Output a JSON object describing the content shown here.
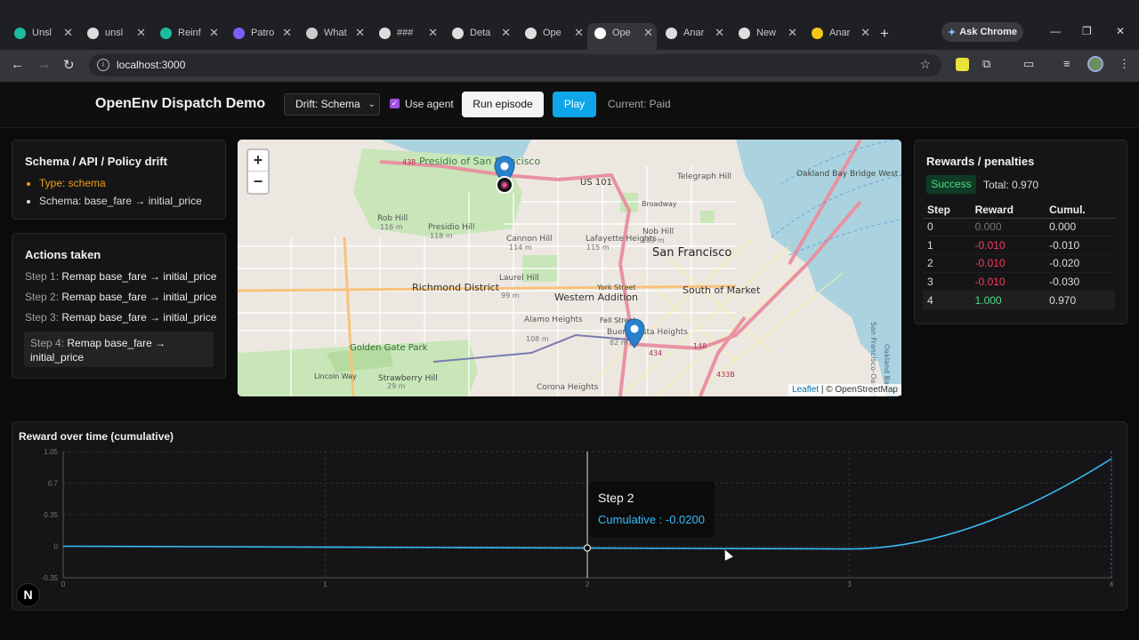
{
  "browser": {
    "tabs": [
      {
        "label": "Unsl",
        "color": "#1abc9c"
      },
      {
        "label": "unsl",
        "color": "#dddddd"
      },
      {
        "label": "Reinf",
        "color": "#1abc9c"
      },
      {
        "label": "Patro",
        "color": "#7c5cff"
      },
      {
        "label": "What",
        "color": "#cccccc"
      },
      {
        "label": "###",
        "color": "#dddddd"
      },
      {
        "label": "Deta",
        "color": "#dddddd"
      },
      {
        "label": "Ope",
        "color": "#dddddd"
      },
      {
        "label": "Ope",
        "color": "#ffffff"
      },
      {
        "label": "Anar",
        "color": "#dddddd"
      },
      {
        "label": "New",
        "color": "#dddddd"
      },
      {
        "label": "Anar",
        "color": "#f5c518"
      }
    ],
    "active_tab_index": 8,
    "ask_chrome": "Ask Chrome",
    "url": "localhost:3000"
  },
  "header": {
    "title": "OpenEnv Dispatch Demo",
    "drift_select": "Drift: Schema",
    "use_agent": "Use agent",
    "use_agent_checked": true,
    "run_button": "Run episode",
    "play_button": "Play",
    "current": "Current: Paid"
  },
  "drift": {
    "title": "Schema / API / Policy drift",
    "type": "Type: schema",
    "schema": "Schema: base_fare → initial_price",
    "type_color": "#f59e0b"
  },
  "actions": {
    "title": "Actions taken",
    "items": [
      {
        "step": "Step 1:",
        "text": "Remap base_fare → initial_price"
      },
      {
        "step": "Step 2:",
        "text": "Remap base_fare → initial_price"
      },
      {
        "step": "Step 3:",
        "text": "Remap base_fare → initial_price"
      },
      {
        "step": "Step 4:",
        "text": "Remap base_fare → initial_price"
      }
    ]
  },
  "map": {
    "labels": [
      "Presidio of San Francisco",
      "US 101",
      "Rob Hill",
      "116 m",
      "Presidio Hill",
      "118 m",
      "Cannon Hill",
      "114 m",
      "Lafayette Heights",
      "115 m",
      "Telegraph Hill",
      "Broadway",
      "Nob Hill",
      "103 m",
      "San Francisco",
      "Oakland Bay Bridge West Span",
      "San Francisco-Oakland Bay Bridge",
      "Richmond District",
      "Laurel Hill",
      "99 m",
      "Western Addition",
      "York Street",
      "South of Market",
      "Fell Street",
      "Alamo Heights",
      "108 m",
      "Buena Vista Heights",
      "82 m",
      "Golden Gate Park",
      "Strawberry Hill",
      "Lincoln Way",
      "29 m",
      "Corona Heights",
      "438",
      "434",
      "433B",
      "148",
      "Oakland Bay St"
    ],
    "attribution_link": "Leaflet",
    "attribution_text": "| © OpenStreetMap"
  },
  "rewards": {
    "title": "Rewards / penalties",
    "badge": "Success",
    "total": "Total: 0.970",
    "columns": [
      "Step",
      "Reward",
      "Cumul."
    ],
    "rows": [
      {
        "step": "0",
        "reward": "0.000",
        "cumul": "0.000",
        "reward_color": "#777777"
      },
      {
        "step": "1",
        "reward": "-0.010",
        "cumul": "-0.010",
        "reward_color": "#f43f5e"
      },
      {
        "step": "2",
        "reward": "-0.010",
        "cumul": "-0.020",
        "reward_color": "#f43f5e"
      },
      {
        "step": "3",
        "reward": "-0.010",
        "cumul": "-0.030",
        "reward_color": "#f43f5e"
      },
      {
        "step": "4",
        "reward": "1.000",
        "cumul": "0.970",
        "reward_color": "#4ade80"
      }
    ]
  },
  "chart_data": {
    "type": "line",
    "title": "Reward over time (cumulative)",
    "x": [
      0,
      1,
      2,
      3,
      4
    ],
    "series": [
      {
        "name": "Cumulative",
        "values": [
          0,
          -0.01,
          -0.02,
          -0.03,
          0.97
        ],
        "color": "#38bdf8"
      }
    ],
    "yticks": [
      "1.05",
      "0.7",
      "0.35",
      "0",
      "-0.35"
    ],
    "xticks": [
      "0",
      "1",
      "2",
      "3",
      "4"
    ],
    "ylim": [
      -0.35,
      1.05
    ],
    "xlim": [
      0,
      4
    ],
    "grid": true,
    "tooltip": {
      "title": "Step 2",
      "label": "Cumulative : -0.0200"
    }
  },
  "nextjs_badge": "N"
}
